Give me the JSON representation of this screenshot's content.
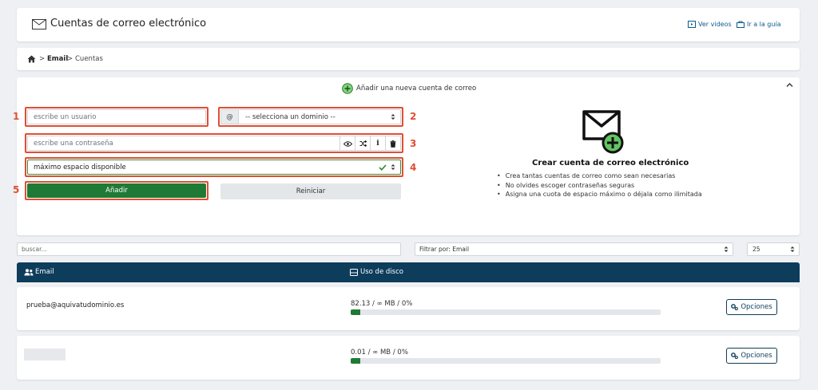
{
  "header": {
    "title": "Cuentas de correo electrónico",
    "links": [
      {
        "label": "Ver videos",
        "icon": "video-icon"
      },
      {
        "label": "Ir a la guía",
        "icon": "guide-icon"
      }
    ]
  },
  "breadcrumb": {
    "home_icon": "home-icon",
    "sep": ">",
    "items": [
      "Email",
      "Cuentas"
    ]
  },
  "form": {
    "toggle_label": "Añadir una nueva cuenta de correo",
    "username_placeholder": "escribe un usuario",
    "domain_prefix": "@",
    "domain_selected": "-- selecciona un dominio --",
    "password_placeholder": "escribe una contraseña",
    "quota_selected": "máximo espacio disponible",
    "add_label": "Añadir",
    "reset_label": "Reiniciar",
    "markers": [
      "1",
      "2",
      "3",
      "4",
      "5"
    ]
  },
  "info": {
    "title": "Crear cuenta de correo electrónico",
    "bullets": [
      "Crea tantas cuentas de correo como sean necesarias",
      "No olvides escoger contraseñas seguras",
      "Asigna una cuota de espacio máximo o déjala como ilimitada"
    ]
  },
  "controls": {
    "search_placeholder": "buscar...",
    "filter_selected": "Filtrar por: Email",
    "page_size": "25"
  },
  "table": {
    "col_email": "Email",
    "col_disk": "Uso de disco",
    "options_label": "Opciones",
    "rows": [
      {
        "email": "prueba@aquivatudominio.es",
        "usage": "82.13 / ∞ MB / 0%",
        "fill": 0.03
      },
      {
        "email": "",
        "usage": "0.01 / ∞ MB / 0%",
        "fill": 0.03
      }
    ]
  },
  "colors": {
    "accent_green": "#1f7a35",
    "header_navy": "#0e3d5c",
    "marker_red": "#e04e33",
    "link_blue": "#0b5c8c"
  }
}
